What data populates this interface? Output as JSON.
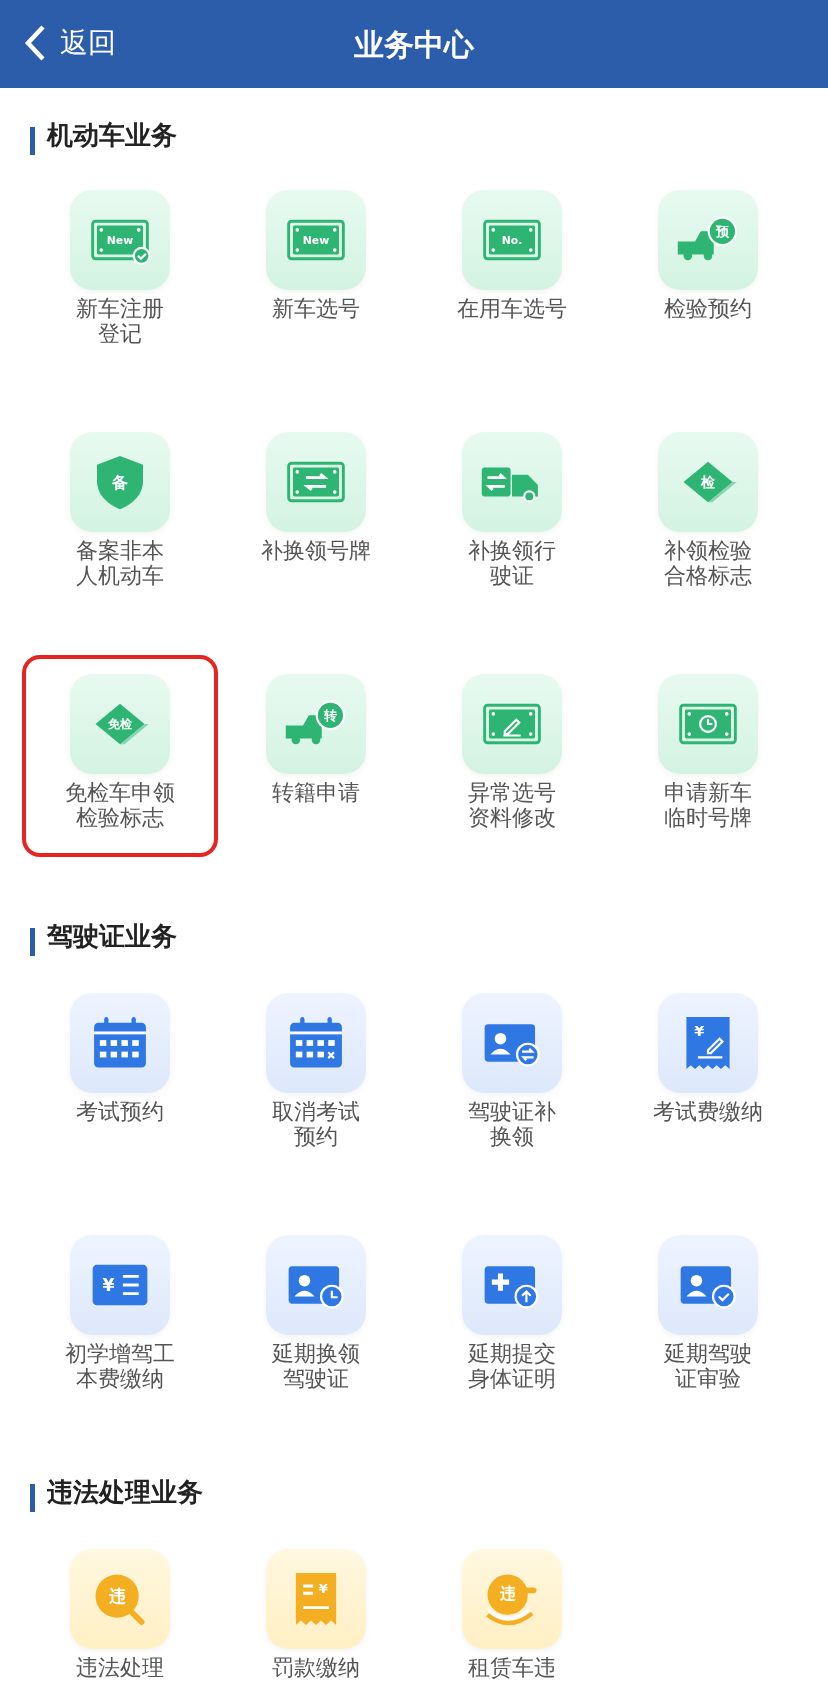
{
  "header": {
    "back": "返回",
    "title": "业务中心"
  },
  "sections": [
    {
      "title": "机动车业务",
      "kind": "vehicle",
      "items": [
        {
          "lines": [
            "新车注册",
            "登记"
          ],
          "glyph": "New",
          "selected": false
        },
        {
          "lines": [
            "新车选号"
          ],
          "glyph": "New",
          "selected": false
        },
        {
          "lines": [
            "在用车选号"
          ],
          "glyph": "No.",
          "selected": false
        },
        {
          "lines": [
            "检验预约"
          ],
          "glyph": "预",
          "selected": false
        },
        {
          "lines": [
            "备案非本",
            "人机动车"
          ],
          "glyph": "备",
          "selected": false
        },
        {
          "lines": [
            "补换领号牌"
          ],
          "selected": false
        },
        {
          "lines": [
            "补换领行",
            "驶证"
          ],
          "selected": false
        },
        {
          "lines": [
            "补领检验",
            "合格标志"
          ],
          "glyph": "检",
          "selected": false
        },
        {
          "lines": [
            "免检车申领",
            "检验标志"
          ],
          "glyph": "免检",
          "selected": true
        },
        {
          "lines": [
            "转籍申请"
          ],
          "glyph": "转",
          "selected": false
        },
        {
          "lines": [
            "异常选号",
            "资料修改"
          ],
          "selected": false
        },
        {
          "lines": [
            "申请新车",
            "临时号牌"
          ],
          "selected": false
        }
      ]
    },
    {
      "title": "驾驶证业务",
      "kind": "license",
      "items": [
        {
          "lines": [
            "考试预约"
          ],
          "selected": false
        },
        {
          "lines": [
            "取消考试",
            "预约"
          ],
          "selected": false
        },
        {
          "lines": [
            "驾驶证补",
            "换领"
          ],
          "selected": false
        },
        {
          "lines": [
            "考试费缴纳"
          ],
          "glyph": "¥",
          "selected": false
        },
        {
          "lines": [
            "初学增驾工",
            "本费缴纳"
          ],
          "glyph": "¥",
          "selected": false
        },
        {
          "lines": [
            "延期换领",
            "驾驶证"
          ],
          "selected": false
        },
        {
          "lines": [
            "延期提交",
            "身体证明"
          ],
          "selected": false
        },
        {
          "lines": [
            "延期驾驶",
            "证审验"
          ],
          "selected": false
        }
      ]
    },
    {
      "title": "违法处理业务",
      "kind": "violation",
      "items": [
        {
          "lines": [
            "违法处理"
          ],
          "glyph": "违",
          "selected": false
        },
        {
          "lines": [
            "罚款缴纳"
          ],
          "glyph": "¥",
          "selected": false
        },
        {
          "lines": [
            "租赁车违"
          ],
          "glyph": "违",
          "selected": false
        }
      ]
    }
  ]
}
